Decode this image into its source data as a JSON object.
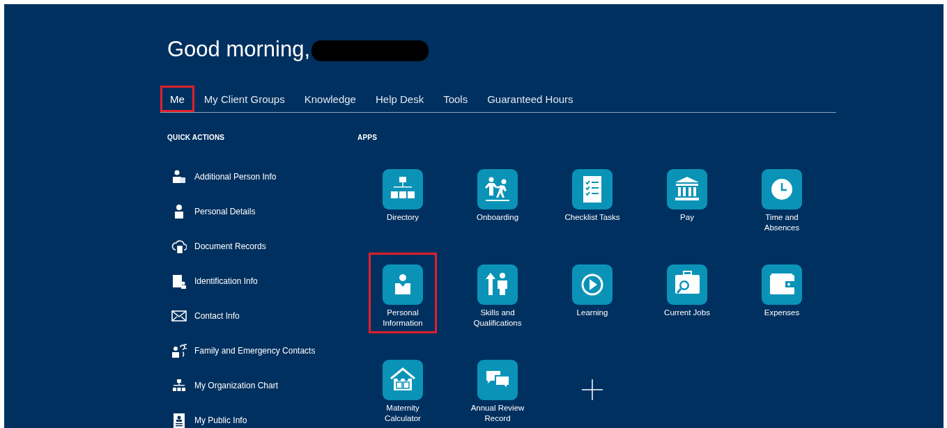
{
  "greeting": {
    "text": "Good morning,",
    "name_redacted": true
  },
  "tabs": [
    {
      "label": "Me",
      "selected": true,
      "highlighted": true
    },
    {
      "label": "My Client Groups",
      "selected": false,
      "highlighted": false
    },
    {
      "label": "Knowledge",
      "selected": false,
      "highlighted": false
    },
    {
      "label": "Help Desk",
      "selected": false,
      "highlighted": false
    },
    {
      "label": "Tools",
      "selected": false,
      "highlighted": false
    },
    {
      "label": "Guaranteed Hours",
      "selected": false,
      "highlighted": false
    }
  ],
  "quick_actions": {
    "title": "QUICK ACTIONS",
    "items": [
      {
        "label": "Additional Person Info"
      },
      {
        "label": "Personal Details"
      },
      {
        "label": "Document Records"
      },
      {
        "label": "Identification Info"
      },
      {
        "label": "Contact Info"
      },
      {
        "label": "Family and Emergency Contacts"
      },
      {
        "label": "My Organization Chart"
      },
      {
        "label": "My Public Info"
      }
    ]
  },
  "apps": {
    "title": "APPS",
    "items": [
      {
        "kind": "app",
        "label": "Directory",
        "highlighted": false
      },
      {
        "kind": "app",
        "label": "Onboarding",
        "highlighted": false
      },
      {
        "kind": "app",
        "label": "Checklist Tasks",
        "highlighted": false
      },
      {
        "kind": "app",
        "label": "Pay",
        "highlighted": false
      },
      {
        "kind": "app",
        "label": "Time and\nAbsences",
        "highlighted": false
      },
      {
        "kind": "app",
        "label": "Personal\nInformation",
        "highlighted": true
      },
      {
        "kind": "app",
        "label": "Skills and\nQualifications",
        "highlighted": false
      },
      {
        "kind": "app",
        "label": "Learning",
        "highlighted": false
      },
      {
        "kind": "app",
        "label": "Current Jobs",
        "highlighted": false
      },
      {
        "kind": "app",
        "label": "Expenses",
        "highlighted": false
      },
      {
        "kind": "app",
        "label": "Maternity\nCalculator",
        "highlighted": false
      },
      {
        "kind": "app",
        "label": "Annual Review\nRecord",
        "highlighted": false
      },
      {
        "kind": "add"
      }
    ]
  }
}
